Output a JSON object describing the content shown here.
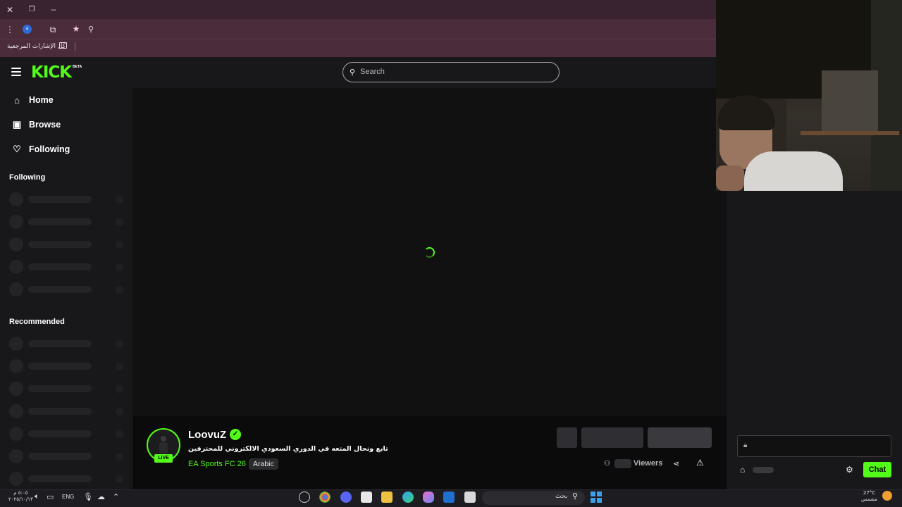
{
  "browser": {
    "bookmarks_label": "كل الإشارات المرجعية"
  },
  "header": {
    "logo": "KICK",
    "logo_badge": "BETA",
    "search_placeholder": "Search"
  },
  "sidebar": {
    "nav": [
      {
        "label": "Home",
        "icon": "home-icon"
      },
      {
        "label": "Browse",
        "icon": "browse-icon"
      },
      {
        "label": "Following",
        "icon": "heart-icon"
      }
    ],
    "following_title": "Following",
    "recommended_title": "Recommended"
  },
  "stream": {
    "channel_name": "LoovuZ",
    "live_label": "LIVE",
    "title": "تابع ونحال المتعه في الدوري السعودي الالكتروني للمحترفين",
    "category": "EA Sports FC 26",
    "language_tag": "Arabic",
    "viewers_label": "Viewers"
  },
  "chat": {
    "send_label": "Chat"
  },
  "taskbar": {
    "search_text": "بحث",
    "language": "ENG",
    "time": "٥:٠٥ م",
    "date": "٢٠٢٥/١٠/١٣",
    "temperature": "27°C",
    "weather": "مشمس"
  },
  "colors": {
    "kick_green": "#53fc18",
    "browser_accent": "#4a2c3b"
  }
}
